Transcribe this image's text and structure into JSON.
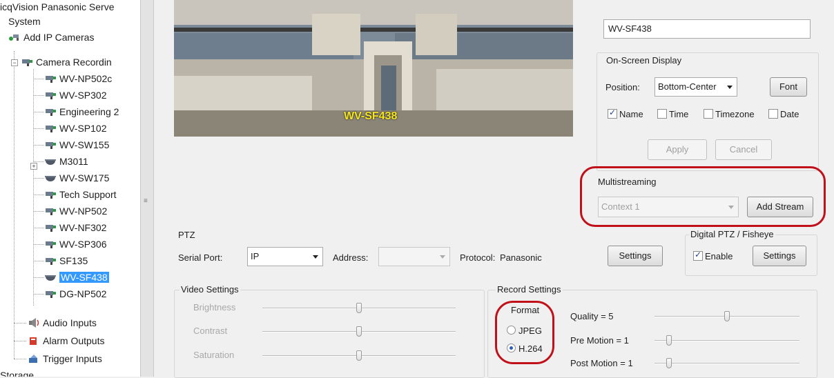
{
  "tree": {
    "root": "icqVision Panasonic Serve",
    "system": "System",
    "add_ip_cameras": "Add IP Cameras",
    "camera_recording": "Camera Recordin",
    "cameras": [
      "WV-NP502c",
      "WV-SP302",
      "Engineering 2",
      "WV-SP102",
      "WV-SW155",
      "M3011",
      "WV-SW175",
      "Tech Support",
      "WV-NP502",
      "WV-NF302",
      "WV-SP306",
      "SF135",
      "WV-SF438",
      "DG-NP502"
    ],
    "selected": "WV-SF438",
    "audio_inputs": "Audio Inputs",
    "alarm_outputs": "Alarm Outputs",
    "trigger_inputs": "Trigger Inputs",
    "storage": "Storage"
  },
  "preview": {
    "overlay_text": "WV-SF438"
  },
  "camera_name": {
    "value": "WV-SF438"
  },
  "osd": {
    "title": "On-Screen Display",
    "position_label": "Position:",
    "position_value": "Bottom-Center",
    "font_button": "Font",
    "checks": [
      {
        "label": "Name",
        "checked": true
      },
      {
        "label": "Time",
        "checked": false
      },
      {
        "label": "Timezone",
        "checked": false
      },
      {
        "label": "Date",
        "checked": false
      }
    ],
    "apply": "Apply",
    "cancel": "Cancel"
  },
  "multistreaming": {
    "title": "Multistreaming",
    "context": "Context 1",
    "add_stream": "Add Stream"
  },
  "ptz": {
    "title": "PTZ",
    "serial_port_label": "Serial Port:",
    "serial_port_value": "IP",
    "address_label": "Address:",
    "protocol_label": "Protocol:",
    "protocol_value": "Panasonic",
    "settings": "Settings"
  },
  "digital_ptz": {
    "title": "Digital PTZ / Fisheye",
    "enable": "Enable",
    "settings": "Settings"
  },
  "video_settings": {
    "title": "Video Settings",
    "sliders": [
      {
        "label": "Brightness",
        "value": 0.5
      },
      {
        "label": "Contrast",
        "value": 0.5
      },
      {
        "label": "Saturation",
        "value": 0.5
      }
    ]
  },
  "record_settings": {
    "title": "Record Settings",
    "format_label": "Format",
    "formats": [
      {
        "label": "JPEG",
        "selected": false
      },
      {
        "label": "H.264",
        "selected": true
      }
    ],
    "quality": {
      "label": "Quality = 5",
      "value": 0.5
    },
    "pre_motion": {
      "label": "Pre Motion = 1",
      "value": 0.1
    },
    "post_motion": {
      "label": "Post Motion = 1",
      "value": 0.1
    }
  },
  "colors": {
    "highlight": "#c0101a",
    "selection": "#3399ff",
    "overlay_text": "#f5e61e"
  }
}
